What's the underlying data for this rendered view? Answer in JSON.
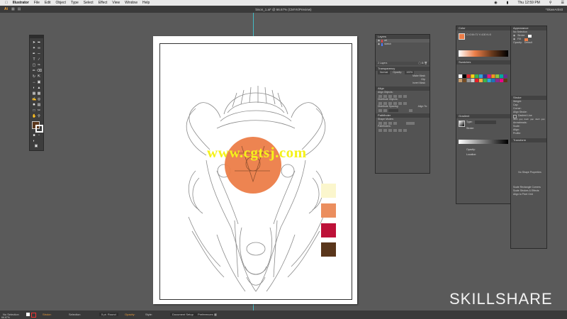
{
  "menubar": {
    "apple": "",
    "items": [
      "Illustrator",
      "File",
      "Edit",
      "Object",
      "Type",
      "Select",
      "Effect",
      "View",
      "Window",
      "Help"
    ],
    "clock": "Thu 12:59 PM"
  },
  "appbar": {
    "app_short": "Ai",
    "document_title": "bison_1.ai* @ 66.67% (CMYK/Preview)",
    "workspace": "*SkweArtistt"
  },
  "layers_panel": {
    "title": "Layers",
    "layers": [
      {
        "name": "art",
        "color": "#e0434b"
      },
      {
        "name": "sketch",
        "color": "#4f7cff"
      }
    ],
    "footer": "2 Layers"
  },
  "transparency_panel": {
    "title": "Transparency",
    "mode": "Normal",
    "opacity_label": "Opacity:",
    "opacity_value": "100%",
    "make_mask": "Make Mask",
    "clip": "Clip",
    "invert": "Invert Mask"
  },
  "align_panel": {
    "title": "Align",
    "align_objects": "Align Objects:",
    "distribute_objects": "Distribute Objects:",
    "distribute_spacing": "Distribute Spacing:",
    "align_to": "Align To:"
  },
  "pathfinder_panel": {
    "title": "Pathfinder",
    "shape_modes": "Shape Modes:",
    "pathfinders": "Pathfinders:"
  },
  "color_panel": {
    "title": "Color",
    "values": "C=0 M=71 Y=100 K=0"
  },
  "swatches_panel": {
    "title": "Swatches"
  },
  "gradient_panel": {
    "title": "Gradient",
    "type_label": "Type:",
    "stroke_label": "Stroke:",
    "opacity_label": "Opacity:",
    "location_label": "Location:"
  },
  "appearance_panel": {
    "title": "Appearance",
    "selection": "No Selection",
    "stroke": "Stroke:",
    "fill": "Fill:",
    "opacity": "Opacity:",
    "opacity_value": "Default"
  },
  "stroke_panel": {
    "title": "Stroke",
    "weight": "Weight:",
    "cap": "Cap:",
    "corner": "Corner:",
    "align_stroke": "Align Stroke:",
    "dashed": "Dashed Line",
    "dash_labels": [
      "dash",
      "gap",
      "dash",
      "gap",
      "dash",
      "gap"
    ],
    "arrowheads": "Arrowheads:",
    "scale": "Scale:",
    "align": "Align:",
    "profile": "Profile:"
  },
  "transform_panel": {
    "title": "Transform",
    "empty": "No Shape Properties",
    "opt1": "Scale Rectangle Corners",
    "opt2": "Scale Strokes & Effects",
    "opt3": "Align to Pixel Grid"
  },
  "swatches_on_artboard": [
    {
      "name": "cream",
      "color": "#fbf6cd"
    },
    {
      "name": "orange",
      "color": "#eb8e5e"
    },
    {
      "name": "crimson",
      "color": "#bd1138"
    },
    {
      "name": "brown",
      "color": "#5a361b"
    }
  ],
  "artwork": {
    "circle_color": "#ec7d48"
  },
  "watermark": "www.cgtsj.com",
  "brand": "SKILLSHARE",
  "statusbar": {
    "left": "No Selection",
    "stroke_label": "Stroke:",
    "brush": "5 pt. Round",
    "opacity_label": "Opacity:",
    "style_label": "Style:",
    "document_setup": "Document Setup",
    "preferences": "Preferences",
    "zoom": "66.67%",
    "artboard_nav": "1",
    "tool": "Selection",
    "bottom_info": "No Graphics on Artbrd"
  },
  "colors": {
    "guide": "#3fc7d1",
    "fill_swatch": "#5a361b",
    "accent": "#ec7d48"
  }
}
